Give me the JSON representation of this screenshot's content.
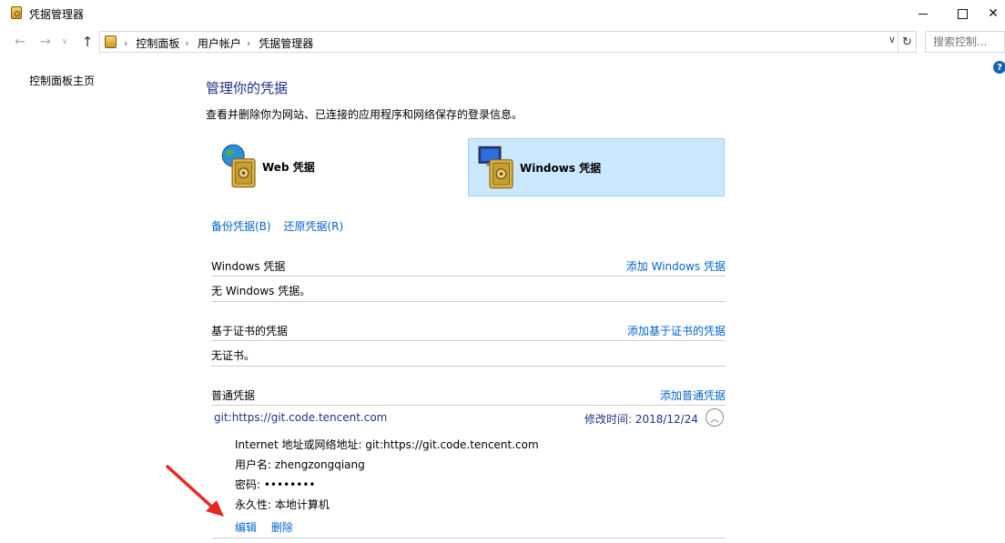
{
  "window": {
    "title": "凭据管理器"
  },
  "address": {
    "crumbs": [
      "控制面板",
      "用户帐户",
      "凭据管理器"
    ],
    "search_placeholder": "搜索控制..."
  },
  "left_pane": {
    "home_link": "控制面板主页"
  },
  "main": {
    "heading": "管理你的凭据",
    "description": "查看并删除你为网站、已连接的应用程序和网络保存的登录信息。",
    "tiles": {
      "web": "Web 凭据",
      "windows": "Windows 凭据"
    },
    "backup_link": "备份凭据(B)",
    "restore_link": "还原凭据(R)",
    "windows_section": {
      "title": "Windows 凭据",
      "action": "添加 Windows 凭据",
      "empty": "无 Windows 凭据。"
    },
    "cert_section": {
      "title": "基于证书的凭据",
      "action": "添加基于证书的凭据",
      "empty": "无证书。"
    },
    "generic_section": {
      "title": "普通凭据",
      "action": "添加普通凭据",
      "entry": {
        "name": "git:https://git.code.tencent.com",
        "modified": "修改时间:  2018/12/24",
        "address": "Internet 地址或网络地址:  git:https://git.code.tencent.com",
        "username": "用户名:  zhengzongqiang",
        "password": "密码:  ••••••••",
        "persistence": "永久性:  本地计算机",
        "edit": "编辑",
        "delete": "删除"
      }
    }
  },
  "colors": {
    "link": "#0066cc",
    "heading": "#1e3287",
    "selected_tile": "#cce8ff",
    "annotation_arrow": "#e8261f"
  }
}
